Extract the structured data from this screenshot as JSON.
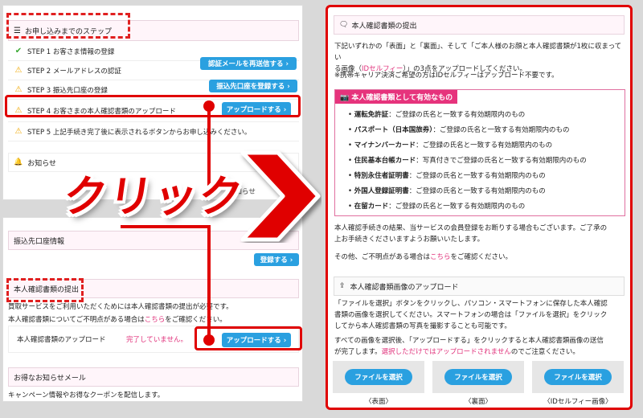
{
  "steps_panel": {
    "title": "お申し込みまでのステップ",
    "steps": [
      {
        "label": "STEP 1  お客さま情報の登録",
        "status": "done"
      },
      {
        "label": "STEP 2  メールアドレスの認証",
        "status": "warn",
        "button": "認証メールを再送信する ›"
      },
      {
        "label": "STEP 3  振込先口座の登録",
        "status": "warn",
        "button": "振込先口座を登録する ›"
      },
      {
        "label": "STEP 4  お客さまの本人確認書類のアップロード",
        "status": "warn",
        "button": "アップロードする ›"
      },
      {
        "label": "STEP 5  上記手続き完了後に表示されるボタンからお申し込みください。",
        "status": "warn"
      }
    ],
    "notice": "お知らせ",
    "notice_partial": "お知らせ"
  },
  "bottom_panel": {
    "bank_title": "振込先口座情報",
    "register_button": "登録する ›",
    "id_title": "本人確認書類の提出",
    "id_text1": "買取サービスをご利用いただくためには本人確認書類の提出が必要です。",
    "id_text2_a": "本人確認書類についてご不明点がある場合は",
    "id_text2_link": "こちら",
    "id_text2_b": "をご確認ください。",
    "upload_label": "本人確認書類のアップロード",
    "upload_status": "完了していません。",
    "upload_button": "アップロードする ›",
    "mail_title": "お得なお知らせメール",
    "mail_text": "キャンペーン情報やお得なクーポンを配信します。"
  },
  "overlay": {
    "click_label": "クリック"
  },
  "right_panel": {
    "title": "本人確認書類の提出",
    "intro": "下記いずれかの「表面」と「裏面」、そして「ご本人様のお顔と本人確認書類が1枚に収まっている画像（IDセルフィー）」の3点をアップロードしてください。",
    "intro_a": "下記いずれかの「表面」と「裏面」、そして「ご本人様のお顔と本人確認書類が1枚に収まってい",
    "intro_b1": "る画像（",
    "intro_b_link": "IDセルフィー",
    "intro_b2": "）」の3点をアップロードしてください。",
    "carrier_note": "※携帯キャリア決済ご希望の方はIDセルフィーはアップロード不要です。",
    "valid_docs_title": "本人確認書類として有効なもの",
    "docs": [
      {
        "name": "運転免許証",
        "desc": "：ご登録の氏名と一致する有効期限内のもの"
      },
      {
        "name": "パスポート（日本国旅券）",
        "desc": "：ご登録の氏名と一致する有効期限内のもの"
      },
      {
        "name": "マイナンバーカード",
        "desc": "：ご登録の氏名と一致する有効期限内のもの"
      },
      {
        "name": "住民基本台帳カード",
        "desc": "：写真付きでご登録の氏名と一致する有効期限内のもの"
      },
      {
        "name": "特別永住者証明書",
        "desc": "：ご登録の氏名と一致する有効期限内のもの"
      },
      {
        "name": "外国人登録証明書",
        "desc": "：ご登録の氏名と一致する有効期限内のもの"
      },
      {
        "name": "在留カード",
        "desc": "：ご登録の氏名と一致する有効期限内のもの"
      }
    ],
    "refuse_1": "本人確認手続きの結果、当サービスの会員登録をお断りする場合もございます。ご了承の",
    "refuse_2": "上お手続きくださいますようお願いいたします。",
    "other_a": "その他、ご不明点がある場合は",
    "other_link": "こちら",
    "other_b": "をご確認ください。",
    "upload_title": "本人確認書類画像のアップロード",
    "upload_p1": "「ファイルを選択」ボタンをクリックし、パソコン・スマートフォンに保存した本人確認",
    "upload_p2": "書類の画像を選択してください。スマートフォンの場合は「ファイルを選択」をクリック",
    "upload_p3": "してから本人確認書類の写真を撮影することも可能です。",
    "final_1": "すべての画像を選択後、「アップロードする」をクリックすると本人確認書類画像の送信",
    "final_2a": "が完了します。",
    "final_2_link": "選択しただけではアップロードされません",
    "final_2b": "のでご注意ください。",
    "file_button": "ファイルを選択",
    "captions": [
      "〈表面〉",
      "〈裏面〉",
      "〈IDセルフィー画像〉"
    ]
  },
  "colors": {
    "accent_red": "#e00000",
    "button_blue": "#2aa0e0",
    "pink": "#e6337c"
  }
}
